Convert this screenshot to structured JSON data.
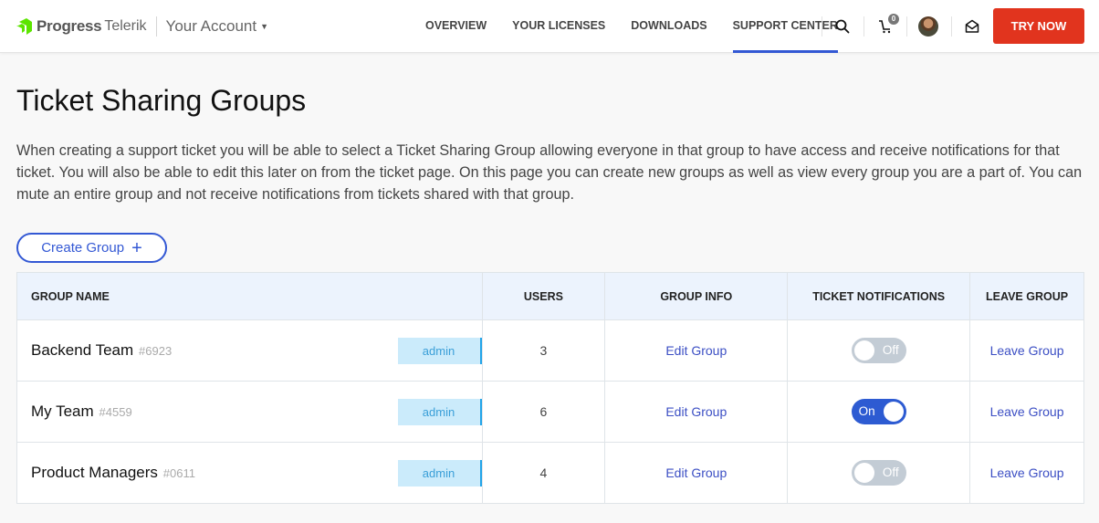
{
  "header": {
    "brand_primary": "Progress",
    "brand_secondary": "Telerik",
    "account_label": "Your Account",
    "nav": [
      {
        "label": "OVERVIEW",
        "active": false
      },
      {
        "label": "YOUR LICENSES",
        "active": false
      },
      {
        "label": "DOWNLOADS",
        "active": false
      },
      {
        "label": "SUPPORT CENTER",
        "active": true
      }
    ],
    "cart_count": "0",
    "try_now_label": "TRY NOW",
    "icons": [
      "search-icon",
      "cart-icon",
      "avatar",
      "mail-icon"
    ]
  },
  "page": {
    "title": "Ticket Sharing Groups",
    "intro": "When creating a support ticket you will be able to select a Ticket Sharing Group allowing everyone in that group to have access and receive notifications for that ticket. You will also be able to edit this later on from the ticket page. On this page you can create new groups as well as view every group you are a part of. You can mute an entire group and not receive notifications from tickets shared with that group.",
    "create_group_label": "Create Group",
    "create_group_icon": "+"
  },
  "table": {
    "columns": [
      "GROUP NAME",
      "USERS",
      "GROUP INFO",
      "TICKET NOTIFICATIONS",
      "LEAVE GROUP"
    ],
    "rows": [
      {
        "name": "Backend Team",
        "id": "#6923",
        "role": "admin",
        "users": "3",
        "info_link": "Edit Group",
        "notifications": "Off",
        "leave_link": "Leave Group"
      },
      {
        "name": "My Team",
        "id": "#4559",
        "role": "admin",
        "users": "6",
        "info_link": "Edit Group",
        "notifications": "On",
        "leave_link": "Leave Group"
      },
      {
        "name": "Product Managers",
        "id": "#0611",
        "role": "admin",
        "users": "4",
        "info_link": "Edit Group",
        "notifications": "Off",
        "leave_link": "Leave Group"
      }
    ]
  },
  "colors": {
    "accent": "#3358d4",
    "try_now": "#e1341e",
    "toggle_on": "#2d5bd2",
    "toggle_off": "#c3ccd5",
    "admin_badge_bg": "#cbebfb",
    "header_row_bg": "#ecf3fd",
    "brand_green": "#5ce500"
  }
}
